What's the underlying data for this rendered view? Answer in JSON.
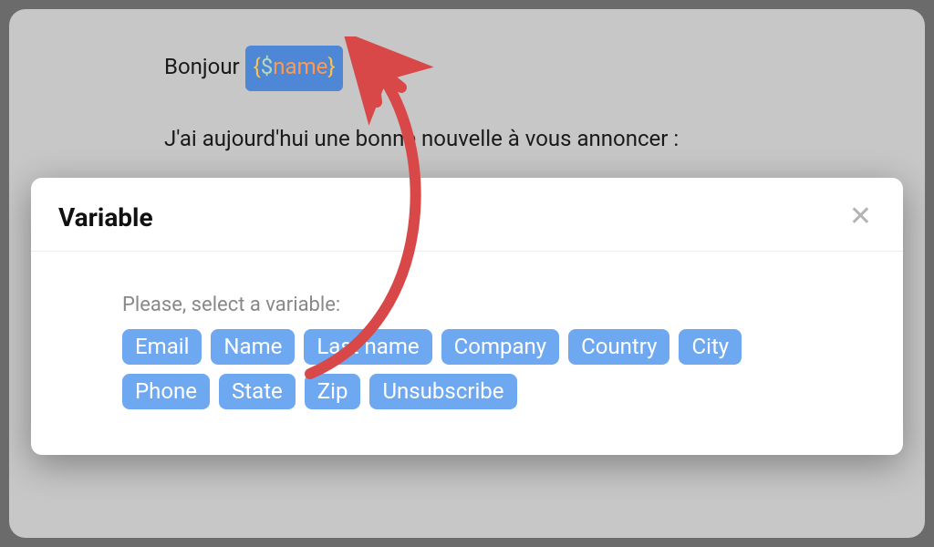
{
  "editor": {
    "greeting_prefix": "Bonjour ",
    "variable_token": {
      "open": "{",
      "dollar": "$",
      "name": "name",
      "close": "}"
    },
    "line2": "J'ai aujourd'hui une bonne nouvelle à vous annoncer :"
  },
  "modal": {
    "title": "Variable",
    "prompt": "Please, select a variable:",
    "variables": [
      "Email",
      "Name",
      "Last name",
      "Company",
      "Country",
      "City",
      "Phone",
      "State",
      "Zip",
      "Unsubscribe"
    ]
  },
  "colors": {
    "chip_bg": "#6ea8f0",
    "inline_chip_bg": "#4d87d6",
    "arrow": "#d94848"
  }
}
